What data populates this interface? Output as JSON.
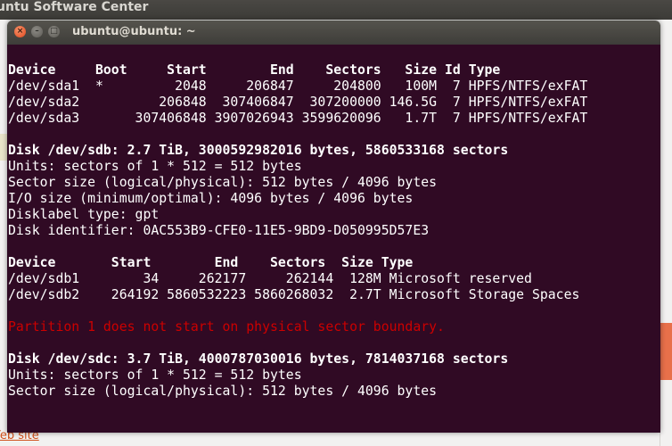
{
  "background_app": {
    "title": "untu Software Center",
    "link": "Veb site"
  },
  "terminal": {
    "title": "ubuntu@ubuntu: ~",
    "buttons": {
      "close": "×",
      "minimize": "–",
      "maximize": "□"
    },
    "colors": {
      "background": "#300a24",
      "text": "#ffffff",
      "error": "#cc0000"
    },
    "lines": [
      {
        "text": "Device     Boot     Start        End    Sectors   Size Id Type",
        "style": "bold"
      },
      {
        "text": "/dev/sda1  *         2048     206847     204800   100M  7 HPFS/NTFS/exFAT",
        "style": "normal"
      },
      {
        "text": "/dev/sda2          206848  307406847  307200000 146.5G  7 HPFS/NTFS/exFAT",
        "style": "normal"
      },
      {
        "text": "/dev/sda3       307406848 3907026943 3599620096   1.7T  7 HPFS/NTFS/exFAT",
        "style": "normal"
      },
      {
        "text": "",
        "style": "normal"
      },
      {
        "text": "Disk /dev/sdb: 2.7 TiB, 3000592982016 bytes, 5860533168 sectors",
        "style": "bold"
      },
      {
        "text": "Units: sectors of 1 * 512 = 512 bytes",
        "style": "normal"
      },
      {
        "text": "Sector size (logical/physical): 512 bytes / 4096 bytes",
        "style": "normal"
      },
      {
        "text": "I/O size (minimum/optimal): 4096 bytes / 4096 bytes",
        "style": "normal"
      },
      {
        "text": "Disklabel type: gpt",
        "style": "normal"
      },
      {
        "text": "Disk identifier: 0AC553B9-CFE0-11E5-9BD9-D050995D57E3",
        "style": "normal"
      },
      {
        "text": "",
        "style": "normal"
      },
      {
        "text": "Device       Start        End    Sectors  Size Type",
        "style": "bold"
      },
      {
        "text": "/dev/sdb1        34     262177     262144  128M Microsoft reserved",
        "style": "normal"
      },
      {
        "text": "/dev/sdb2    264192 5860532223 5860268032  2.7T Microsoft Storage Spaces",
        "style": "normal"
      },
      {
        "text": "",
        "style": "normal"
      },
      {
        "text": "Partition 1 does not start on physical sector boundary.",
        "style": "error"
      },
      {
        "text": "",
        "style": "normal"
      },
      {
        "text": "Disk /dev/sdc: 3.7 TiB, 4000787030016 bytes, 7814037168 sectors",
        "style": "bold"
      },
      {
        "text": "Units: sectors of 1 * 512 = 512 bytes",
        "style": "normal"
      },
      {
        "text": "Sector size (logical/physical): 512 bytes / 4096 bytes",
        "style": "normal"
      }
    ]
  }
}
